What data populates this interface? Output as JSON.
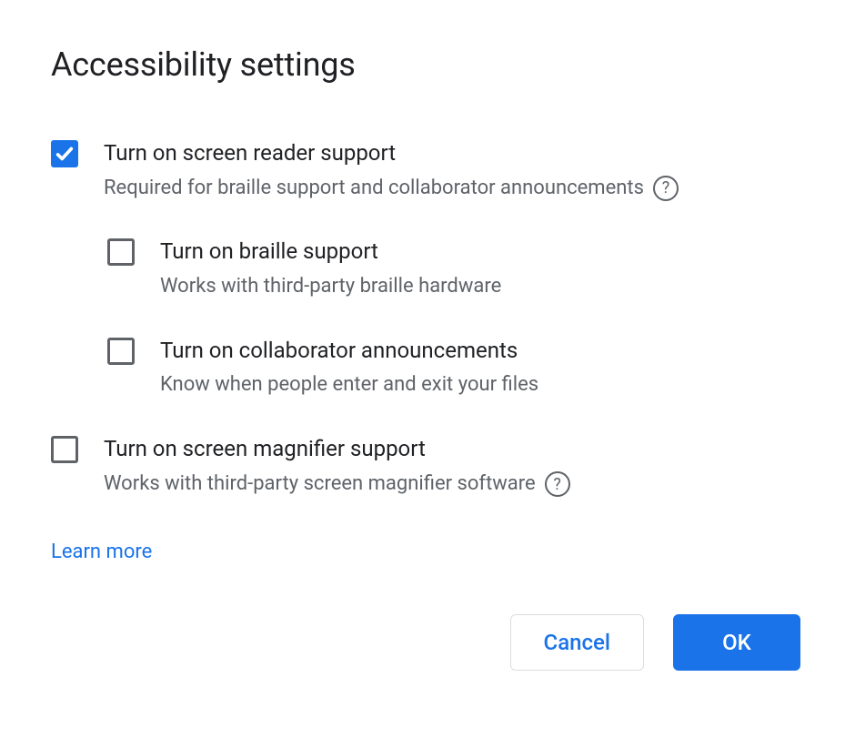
{
  "dialog": {
    "title": "Accessibility settings",
    "options": {
      "screen_reader": {
        "label": "Turn on screen reader support",
        "desc": "Required for braille support and collaborator announcements",
        "checked": true,
        "help": true
      },
      "braille": {
        "label": "Turn on braille support",
        "desc": "Works with third-party braille hardware",
        "checked": false,
        "help": false
      },
      "collaborator": {
        "label": "Turn on collaborator announcements",
        "desc": "Know when people enter and exit your files",
        "checked": false,
        "help": false
      },
      "magnifier": {
        "label": "Turn on screen magnifier support",
        "desc": "Works with third-party screen magnifier software",
        "checked": false,
        "help": true
      }
    },
    "learn_more": "Learn more",
    "buttons": {
      "cancel": "Cancel",
      "ok": "OK"
    }
  }
}
